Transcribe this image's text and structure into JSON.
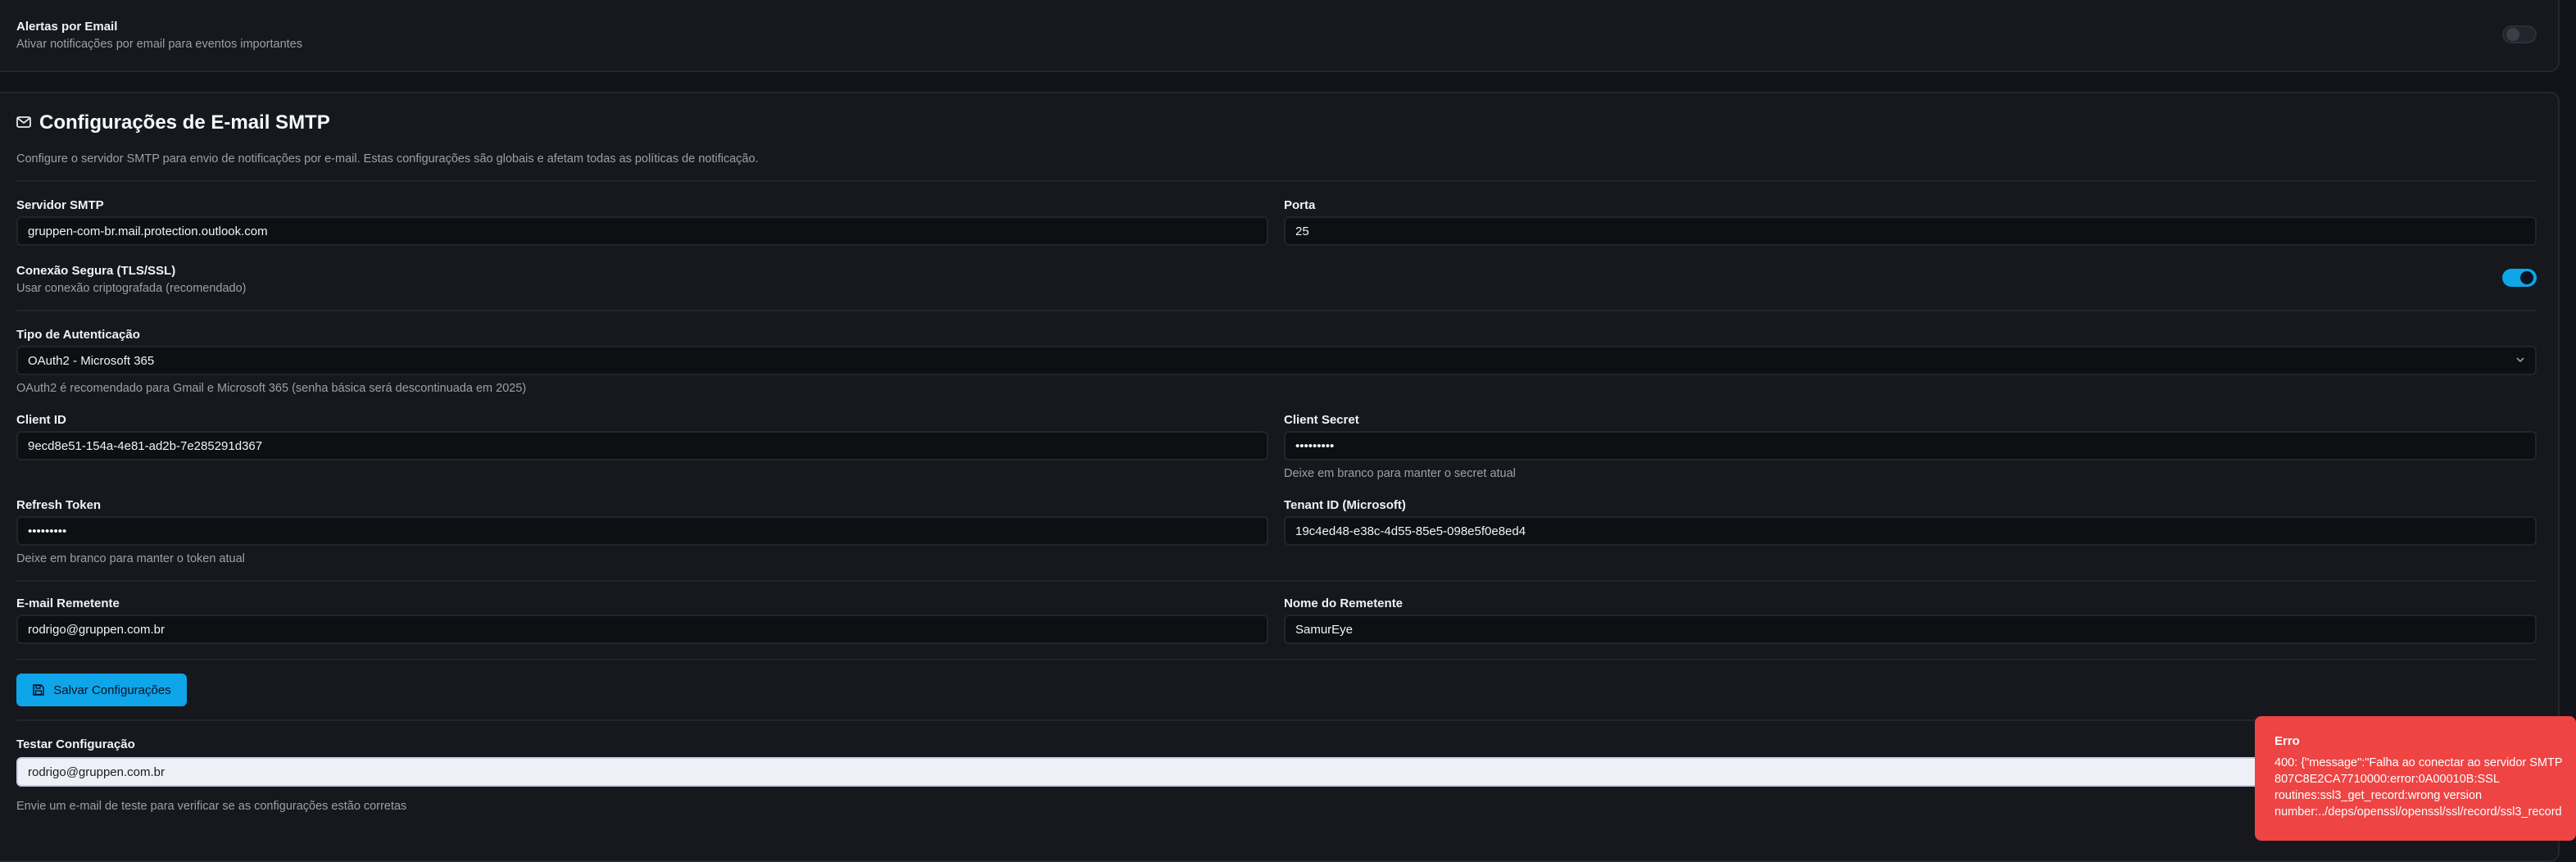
{
  "email_alerts": {
    "title": "Alertas por Email",
    "description": "Ativar notificações por email para eventos importantes",
    "enabled": false
  },
  "smtp": {
    "title": "Configurações de E-mail SMTP",
    "description": "Configure o servidor SMTP para envio de notificações por e-mail. Estas configurações são globais e afetam todas as políticas de notificação.",
    "server_label": "Servidor SMTP",
    "server_value": "gruppen-com-br.mail.protection.outlook.com",
    "port_label": "Porta",
    "port_value": "25",
    "secure_label": "Conexão Segura (TLS/SSL)",
    "secure_description": "Usar conexão criptografada (recomendado)",
    "secure_enabled": true,
    "auth_label": "Tipo de Autenticação",
    "auth_value": "OAuth2 - Microsoft 365",
    "auth_help": "OAuth2 é recomendado para Gmail e Microsoft 365 (senha básica será descontinuada em 2025)",
    "client_id_label": "Client ID",
    "client_id_value": "9ecd8e51-154a-4e81-ad2b-7e285291d367",
    "client_secret_label": "Client Secret",
    "client_secret_value": "•••••••••",
    "client_secret_help": "Deixe em branco para manter o secret atual",
    "refresh_token_label": "Refresh Token",
    "refresh_token_value": "•••••••••",
    "refresh_token_help": "Deixe em branco para manter o token atual",
    "tenant_id_label": "Tenant ID (Microsoft)",
    "tenant_id_value": "19c4ed48-e38c-4d55-85e5-098e5f0e8ed4",
    "sender_email_label": "E-mail Remetente",
    "sender_email_value": "rodrigo@gruppen.com.br",
    "sender_name_label": "Nome do Remetente",
    "sender_name_value": "SamurEye",
    "save_button": "Salvar Configurações",
    "test_label": "Testar Configuração",
    "test_value": "rodrigo@gruppen.com.br",
    "test_help": "Envie um e-mail de teste para verificar se as configurações estão corretas"
  },
  "toast": {
    "title": "Erro",
    "lines": [
      "400: {\"message\":\"Falha ao conectar ao servidor SMTP",
      "807C8E2CA7710000:error:0A00010B:SSL",
      "routines:ssl3_get_record:wrong version",
      "number:../deps/openssl/openssl/ssl/record/ssl3_record"
    ]
  },
  "colors": {
    "accent": "#0ea5e9",
    "error": "#ef4444",
    "background": "#121419"
  },
  "icons": {
    "smtp_title": "mail-icon",
    "save_button": "save-icon",
    "auth_select": "chevron-down-icon"
  }
}
